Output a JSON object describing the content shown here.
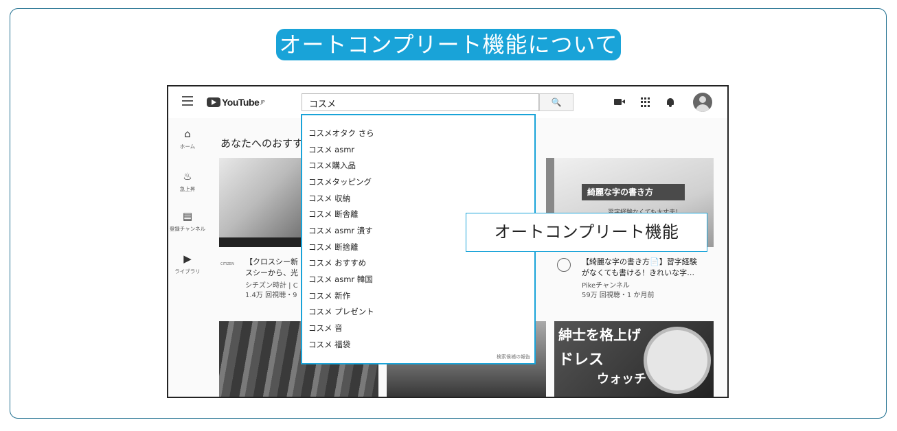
{
  "heading": "オートコンプリート機能について",
  "youtube": {
    "logo_text": "YouTube",
    "logo_region": "JP",
    "search_value": "コスメ",
    "search_button": "🔍",
    "side_nav": [
      {
        "icon": "home-icon",
        "label": "ホーム"
      },
      {
        "icon": "trending-icon",
        "label": "急上昇"
      },
      {
        "icon": "subscriptions-icon",
        "label": "登録チャンネル"
      },
      {
        "icon": "library-icon",
        "label": "ライブラリ"
      }
    ],
    "section_title": "あなたへのおすす",
    "videos": [
      {
        "title_1": "【クロスシー新",
        "title_2": "スシーから、光",
        "channel": "シチズン時計 | C",
        "meta": "1.4万 回視聴・9"
      },
      {
        "thumb_text": "綺麗な字の書き方",
        "thumb_sub": "習字経験なくても大丈夫！",
        "title_1": "【綺麗な字の書き方📄】習字経験",
        "title_2": "がなくても書ける！きれいな字…",
        "channel": "Pikeチャンネル",
        "meta": "59万 回視聴・1 か月前"
      },
      {
        "thumb_text_1": "紳士を格上げ",
        "thumb_text_2": "ドレス",
        "thumb_text_3": "ウォッチ"
      }
    ]
  },
  "autocomplete": {
    "suggestions": [
      "コスメオタク さら",
      "コスメ asmr",
      "コスメ購入品",
      "コスメタッピング",
      "コスメ 収納",
      "コスメ 断舎離",
      "コスメ asmr 潰す",
      "コスメ 断捨離",
      "コスメ おすすめ",
      "コスメ asmr 韓国",
      "コスメ 新作",
      "コスメ プレゼント",
      "コスメ 音",
      "コスメ 福袋"
    ],
    "report_link": "検索候補の報告"
  },
  "callout": "オートコンプリート機能",
  "colors": {
    "accent": "#19a3d8",
    "frame": "#1f6f8f"
  }
}
